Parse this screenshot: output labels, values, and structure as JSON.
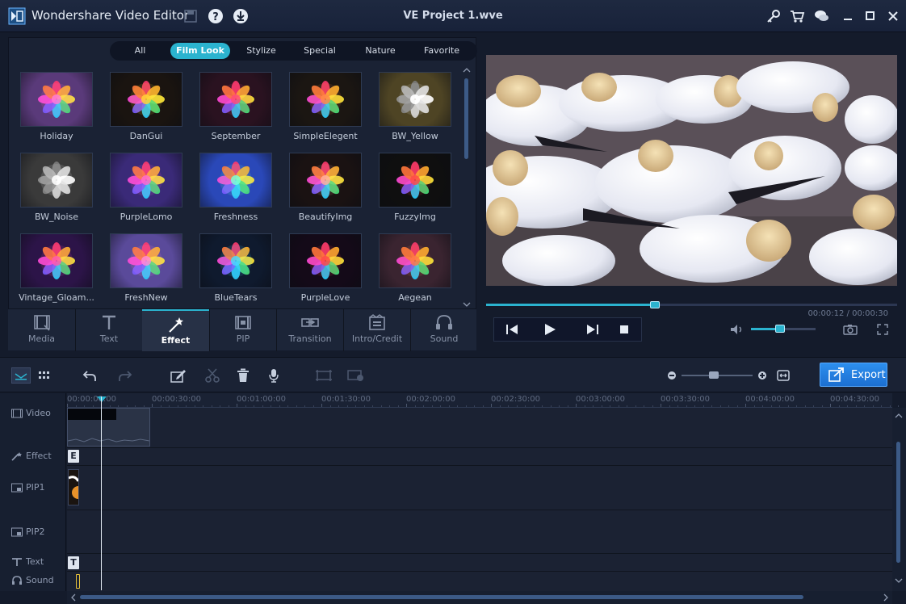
{
  "app": {
    "title": "Wondershare Video Editor",
    "project": "VE Project 1.wve"
  },
  "filters": {
    "tabs": [
      {
        "label": "All",
        "active": false
      },
      {
        "label": "Film Look",
        "active": true
      },
      {
        "label": "Stylize",
        "active": false
      },
      {
        "label": "Special",
        "active": false
      },
      {
        "label": "Nature",
        "active": false
      },
      {
        "label": "Favorite",
        "active": false
      }
    ]
  },
  "effects": [
    {
      "label": "Holiday",
      "bg": "#5a3a7a",
      "tint": "#ff7ad8"
    },
    {
      "label": "DanGui",
      "bg": "#1a1410",
      "tint": "#ffd23a"
    },
    {
      "label": "September",
      "bg": "#2a1220",
      "tint": "#ff4a7a"
    },
    {
      "label": "SimpleElegent",
      "bg": "#1b1612",
      "tint": "#ff8a4a"
    },
    {
      "label": "BW_Yellow",
      "bg": "#4e4424",
      "tint": "#e8e0a8"
    },
    {
      "label": "BW_Noise",
      "bg": "#3a3a3a",
      "tint": "#d8d8d8"
    },
    {
      "label": "PurpleLomo",
      "bg": "#3a2a78",
      "tint": "#ff6ad0"
    },
    {
      "label": "Freshness",
      "bg": "#2a48b8",
      "tint": "#7affd8"
    },
    {
      "label": "BeautifyImg",
      "bg": "#1a1212",
      "tint": "#ffb0a0"
    },
    {
      "label": "FuzzyImg",
      "bg": "#0f0f0f",
      "tint": "#ff4a4a"
    },
    {
      "label": "Vintage_Gloam...",
      "bg": "#2c1448",
      "tint": "#ff5ab0"
    },
    {
      "label": "FreshNew",
      "bg": "#5a4a9a",
      "tint": "#ff8ad8"
    },
    {
      "label": "BlueTears",
      "bg": "#0f1a2e",
      "tint": "#4ad8ff"
    },
    {
      "label": "PurpleLove",
      "bg": "#140a18",
      "tint": "#ff4a4a"
    },
    {
      "label": "Aegean",
      "bg": "#3a2430",
      "tint": "#ff7a4a"
    }
  ],
  "categories": [
    {
      "label": "Media",
      "icon": "media-icon",
      "active": false
    },
    {
      "label": "Text",
      "icon": "text-icon",
      "active": false
    },
    {
      "label": "Effect",
      "icon": "magic-wand-icon",
      "active": true
    },
    {
      "label": "PIP",
      "icon": "pip-icon",
      "active": false
    },
    {
      "label": "Transition",
      "icon": "transition-icon",
      "active": false
    },
    {
      "label": "Intro/Credit",
      "icon": "intro-credit-icon",
      "active": false
    },
    {
      "label": "Sound",
      "icon": "headphones-icon",
      "active": false
    }
  ],
  "player": {
    "time": "00:00:12 / 00:00:30",
    "progress": 0.41,
    "volume": 0.45
  },
  "timeline": {
    "export_label": "Export",
    "zoom": 0.45,
    "ticks": [
      "00:00:00:00",
      "00:00:30:00",
      "00:01:00:00",
      "00:01:30:00",
      "00:02:00:00",
      "00:02:30:00",
      "00:03:00:00",
      "00:03:30:00",
      "00:04:00:00",
      "00:04:30:00"
    ],
    "tracks": {
      "video": "Video",
      "effect": "Effect",
      "pip1": "PIP1",
      "pip2": "PIP2",
      "text": "Text",
      "sound": "Sound"
    },
    "effect_clip": "E",
    "text_clip": "T"
  },
  "colors": {
    "accent": "#2bb3cf",
    "export": "#1f7ad8"
  }
}
